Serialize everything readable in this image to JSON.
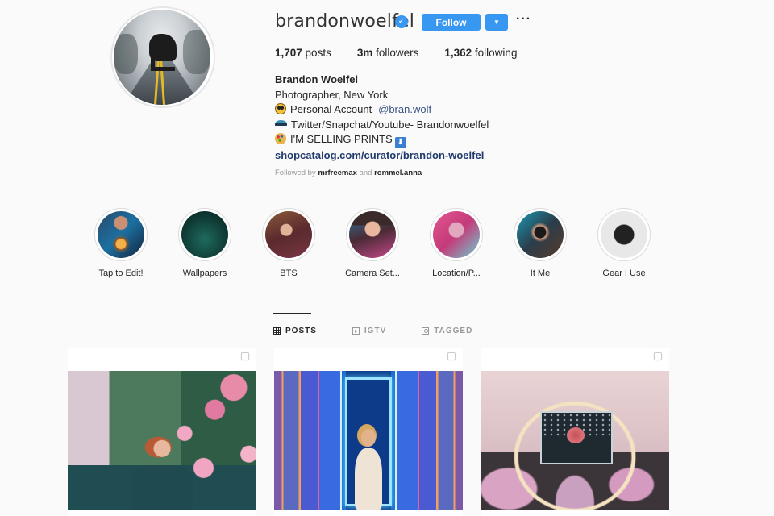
{
  "profile": {
    "username": "brandonwoelfel",
    "verified_icon": "✓",
    "follow_label": "Follow",
    "dropdown_icon": "▼",
    "more_icon": "···",
    "stats": {
      "posts_count": "1,707",
      "posts_label": " posts",
      "followers_count": "3m",
      "followers_label": " followers",
      "following_count": "1,362",
      "following_label": " following"
    },
    "bio": {
      "name": "Brandon Woelfel",
      "line1": "Photographer, New York",
      "line2_text": "Personal Account- ",
      "line2_mention": "@bran.wolf",
      "line3_text": "Twitter/Snapchat/Youtube- Brandonwoelfel",
      "line4_text": "I'M SELLING PRINTS",
      "line4_icon": "⬇",
      "url": "shopcatalog.com/curator/brandon-woelfel"
    },
    "followed_by": {
      "prefix": "Followed by ",
      "user1": "mrfreemax",
      "conjunction": " and ",
      "user2": "rommel.anna"
    }
  },
  "highlights": [
    {
      "label": "Tap to Edit!"
    },
    {
      "label": "Wallpapers"
    },
    {
      "label": "BTS"
    },
    {
      "label": "Camera Set..."
    },
    {
      "label": "Location/P..."
    },
    {
      "label": "It Me"
    },
    {
      "label": "Gear I Use"
    }
  ],
  "tabs": [
    {
      "label": "POSTS",
      "icon": "grid-icon",
      "active": true
    },
    {
      "label": "IGTV",
      "icon": "igtv-icon",
      "active": false
    },
    {
      "label": "TAGGED",
      "icon": "tagged-icon",
      "active": false
    }
  ],
  "posts": [
    {
      "subject": "woman with roses"
    },
    {
      "subject": "woman in neon doorway"
    },
    {
      "subject": "framed rose with string lights"
    }
  ],
  "colors": {
    "accent": "#3897f0",
    "link": "#385185",
    "background": "#fafafa"
  }
}
